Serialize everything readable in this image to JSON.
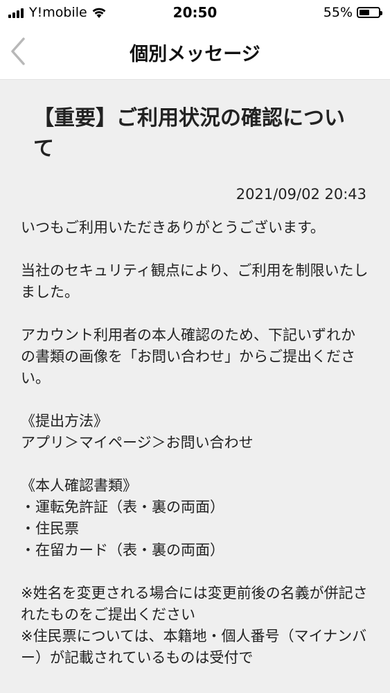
{
  "status_bar": {
    "carrier": "Y!mobile",
    "time": "20:50",
    "battery_percent": "55%",
    "battery_level": 0.55
  },
  "nav": {
    "title": "個別メッセージ",
    "back_icon": "chevron-left-icon"
  },
  "message": {
    "title": "【重要】ご利用状況の確認について",
    "date": "2021/09/02 20:43",
    "paragraphs": [
      {
        "lines": [
          "いつもご利用いただきありがとうございます。"
        ]
      },
      {
        "lines": [
          "当社のセキュリティ観点により、ご利用を制限いたしました。"
        ]
      },
      {
        "lines": [
          "アカウント利用者の本人確認のため、下記いずれかの書類の画像を「お問い合わせ」からご提出ください。"
        ]
      },
      {
        "lines": [
          "《提出方法》",
          "アプリ＞マイページ＞お問い合わせ"
        ]
      },
      {
        "lines": [
          "《本人確認書類》",
          "・運転免許証（表・裏の両面）",
          "・住民票",
          "・在留カード（表・裏の両面）"
        ]
      },
      {
        "lines": [
          "※姓名を変更される場合には変更前後の名義が併記されたものをご提出ください",
          "※住民票については、本籍地・個人番号（マイナンバー）が記載されているものは受付で"
        ]
      }
    ]
  }
}
